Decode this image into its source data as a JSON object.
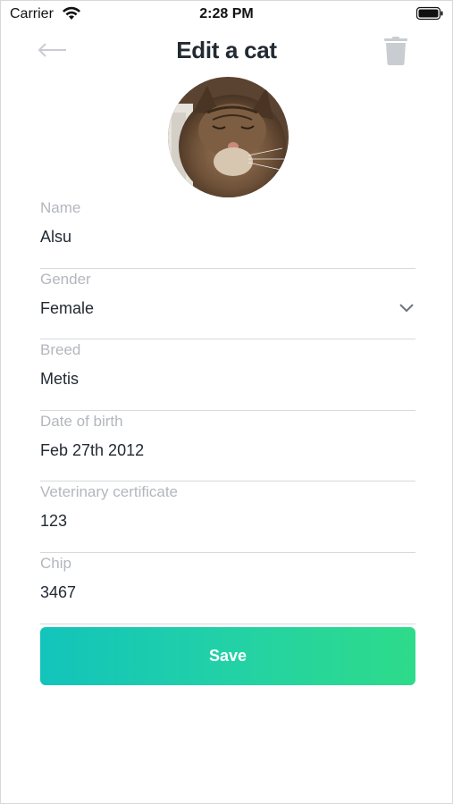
{
  "status_bar": {
    "carrier": "Carrier",
    "time": "2:28 PM"
  },
  "header": {
    "title": "Edit a cat",
    "back_icon": "arrow-left-icon",
    "delete_icon": "trash-icon"
  },
  "avatar": {
    "icon": "cat-photo"
  },
  "form": {
    "fields": [
      {
        "label": "Name",
        "value": "Alsu"
      },
      {
        "label": "Gender",
        "value": "Female"
      },
      {
        "label": "Breed",
        "value": "Metis"
      },
      {
        "label": "Date of birth",
        "value": "Feb 27th 2012"
      },
      {
        "label": "Veterinary certificate",
        "value": "123"
      },
      {
        "label": "Chip",
        "value": "3467"
      }
    ]
  },
  "save_button": {
    "label": "Save"
  },
  "colors": {
    "accent_start": "#12c4bb",
    "accent_end": "#2edb8a",
    "title": "#222a33",
    "label": "#b3b7bc",
    "icon_gray": "#c9cdd2"
  }
}
